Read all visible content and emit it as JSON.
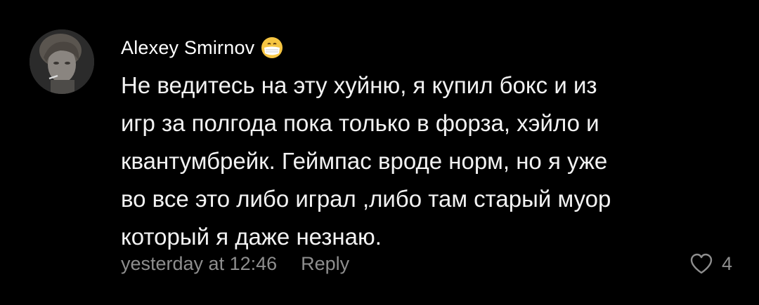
{
  "comment": {
    "author": "Alexey Smirnov",
    "author_emoji_icon": "face-with-medical-mask-icon",
    "text": "Не ведитесь на эту хуйню, я купил бокс и из\nигр за полгода пока только в форза, хэйло и\nквантумбрейк. Геймпас вроде норм, но я уже\nво все это либо играл ,либо там старый муор\nкоторый я даже незнаю.",
    "timestamp": "yesterday at 12:46",
    "reply_label": "Reply",
    "like_icon": "heart-outline-icon",
    "like_count": "4"
  },
  "colors": {
    "background": "#000000",
    "text": "#f2f2f2",
    "secondary": "#8e8e8e"
  }
}
